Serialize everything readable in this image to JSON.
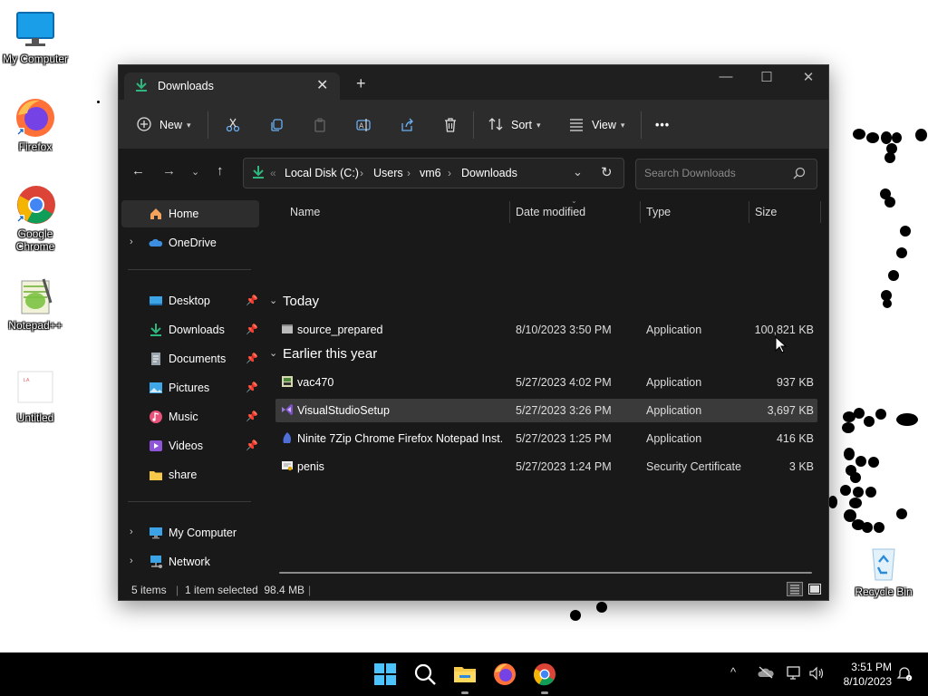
{
  "desktop": {
    "icons": [
      {
        "label": "My Computer",
        "icon": "monitor-icon"
      },
      {
        "label": "Firefox",
        "icon": "firefox-icon"
      },
      {
        "label": "Google Chrome",
        "icon": "chrome-icon"
      },
      {
        "label": "Notepad++",
        "icon": "notepadpp-icon"
      },
      {
        "label": "Untitled",
        "icon": "document-icon"
      },
      {
        "label": "Recycle Bin",
        "icon": "recycle-bin-icon"
      }
    ]
  },
  "window": {
    "tab_label": "Downloads",
    "tab_close": "✕",
    "new_tab": "+",
    "controls": {
      "minimize": "—",
      "maximize": "☐",
      "close": "✕"
    }
  },
  "toolbar": {
    "new_label": "New",
    "sort_label": "Sort",
    "view_label": "View",
    "more_label": "•••"
  },
  "address": {
    "overflow": "«",
    "crumbs": [
      "Local Disk (C:)",
      "Users",
      "vm6",
      "Downloads"
    ],
    "search_placeholder": "Search Downloads"
  },
  "sidebar": {
    "items": [
      {
        "label": "Home",
        "icon": "home-icon",
        "selected": true
      },
      {
        "label": "OneDrive",
        "icon": "cloud-icon",
        "expandable": true
      },
      {
        "label": "Desktop",
        "icon": "desktop-folder-icon",
        "pinned": true
      },
      {
        "label": "Downloads",
        "icon": "download-icon",
        "pinned": true
      },
      {
        "label": "Documents",
        "icon": "documents-icon",
        "pinned": true
      },
      {
        "label": "Pictures",
        "icon": "pictures-icon",
        "pinned": true
      },
      {
        "label": "Music",
        "icon": "music-icon",
        "pinned": true
      },
      {
        "label": "Videos",
        "icon": "videos-icon",
        "pinned": true
      },
      {
        "label": "share",
        "icon": "folder-icon"
      },
      {
        "label": "My Computer",
        "icon": "monitor-icon",
        "expandable": true
      },
      {
        "label": "Network",
        "icon": "network-icon",
        "expandable": true
      }
    ]
  },
  "columns": {
    "name": "Name",
    "date": "Date modified",
    "type": "Type",
    "size": "Size"
  },
  "groups": [
    {
      "title": "Today",
      "rows": [
        {
          "name": "source_prepared",
          "date": "8/10/2023 3:50 PM",
          "type": "Application",
          "size": "100,821 KB",
          "icon": "app-generic-icon"
        }
      ]
    },
    {
      "title": "Earlier this year",
      "rows": [
        {
          "name": "vac470",
          "date": "5/27/2023 4:02 PM",
          "type": "Application",
          "size": "937 KB",
          "icon": "app-installer-icon"
        },
        {
          "name": "VisualStudioSetup",
          "date": "5/27/2023 3:26 PM",
          "type": "Application",
          "size": "3,697 KB",
          "icon": "visual-studio-icon",
          "selected": true
        },
        {
          "name": "Ninite 7Zip Chrome Firefox Notepad Inst...",
          "date": "5/27/2023 1:25 PM",
          "type": "Application",
          "size": "416 KB",
          "icon": "ninite-icon"
        },
        {
          "name": "penis",
          "date": "5/27/2023 1:24 PM",
          "type": "Security Certificate",
          "size": "3 KB",
          "icon": "certificate-icon"
        }
      ]
    }
  ],
  "status": {
    "items": "5 items",
    "selection": "1 item selected  98.4 MB"
  },
  "taskbar": {
    "apps": [
      "start-icon",
      "search-icon",
      "file-explorer-icon",
      "firefox-icon",
      "chrome-icon"
    ],
    "time": "3:51 PM",
    "date": "8/10/2023"
  },
  "colors": {
    "window_bg": "#191919",
    "toolbar_bg": "#2c2c2c",
    "accent_green": "#2eb67d",
    "selection": "#3a3a3a"
  }
}
